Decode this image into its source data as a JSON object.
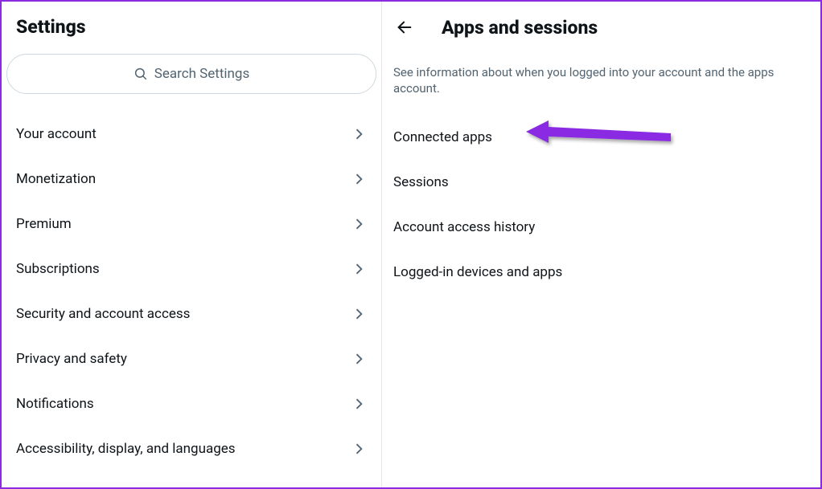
{
  "leftPanel": {
    "title": "Settings",
    "searchPlaceholder": "Search Settings",
    "menuItems": [
      {
        "label": "Your account"
      },
      {
        "label": "Monetization"
      },
      {
        "label": "Premium"
      },
      {
        "label": "Subscriptions"
      },
      {
        "label": "Security and account access"
      },
      {
        "label": "Privacy and safety"
      },
      {
        "label": "Notifications"
      },
      {
        "label": "Accessibility, display, and languages"
      }
    ]
  },
  "rightPanel": {
    "title": "Apps and sessions",
    "description": "See information about when you logged into your account and the apps account.",
    "items": [
      {
        "label": "Connected apps"
      },
      {
        "label": "Sessions"
      },
      {
        "label": "Account access history"
      },
      {
        "label": "Logged-in devices and apps"
      }
    ]
  },
  "annotation": {
    "arrowColor": "#8a2be2"
  }
}
